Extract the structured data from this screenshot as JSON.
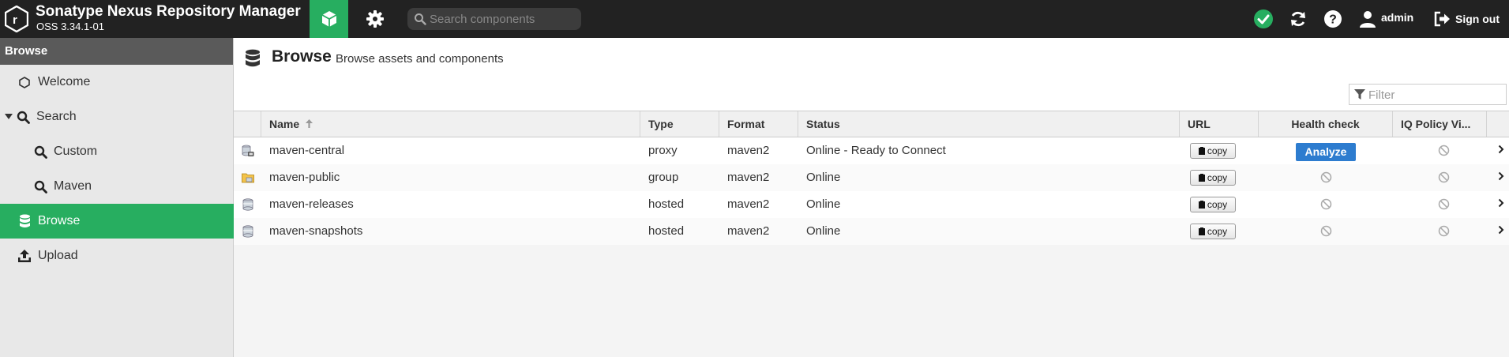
{
  "header": {
    "title": "Sonatype Nexus Repository Manager",
    "version": "OSS 3.34.1-01",
    "search_placeholder": "Search components",
    "user": "admin",
    "signout": "Sign out"
  },
  "sidebar": {
    "title": "Browse",
    "items": [
      {
        "label": "Welcome"
      },
      {
        "label": "Search"
      },
      {
        "label": "Custom"
      },
      {
        "label": "Maven"
      },
      {
        "label": "Browse"
      },
      {
        "label": "Upload"
      }
    ]
  },
  "main": {
    "title": "Browse",
    "subtitle": "Browse assets and components",
    "filter_placeholder": "Filter",
    "columns": {
      "name": "Name",
      "type": "Type",
      "format": "Format",
      "status": "Status",
      "url": "URL",
      "health": "Health check",
      "iq": "IQ Policy Vi..."
    },
    "copy_label": "copy",
    "analyze_label": "Analyze",
    "rows": [
      {
        "name": "maven-central",
        "type": "proxy",
        "format": "maven2",
        "status": "Online - Ready to Connect"
      },
      {
        "name": "maven-public",
        "type": "group",
        "format": "maven2",
        "status": "Online"
      },
      {
        "name": "maven-releases",
        "type": "hosted",
        "format": "maven2",
        "status": "Online"
      },
      {
        "name": "maven-snapshots",
        "type": "hosted",
        "format": "maven2",
        "status": "Online"
      }
    ]
  },
  "colors": {
    "accent": "#27ae60",
    "header_bg": "#222222",
    "analyze": "#2d7ccf",
    "status_ok": "#27ae60"
  }
}
